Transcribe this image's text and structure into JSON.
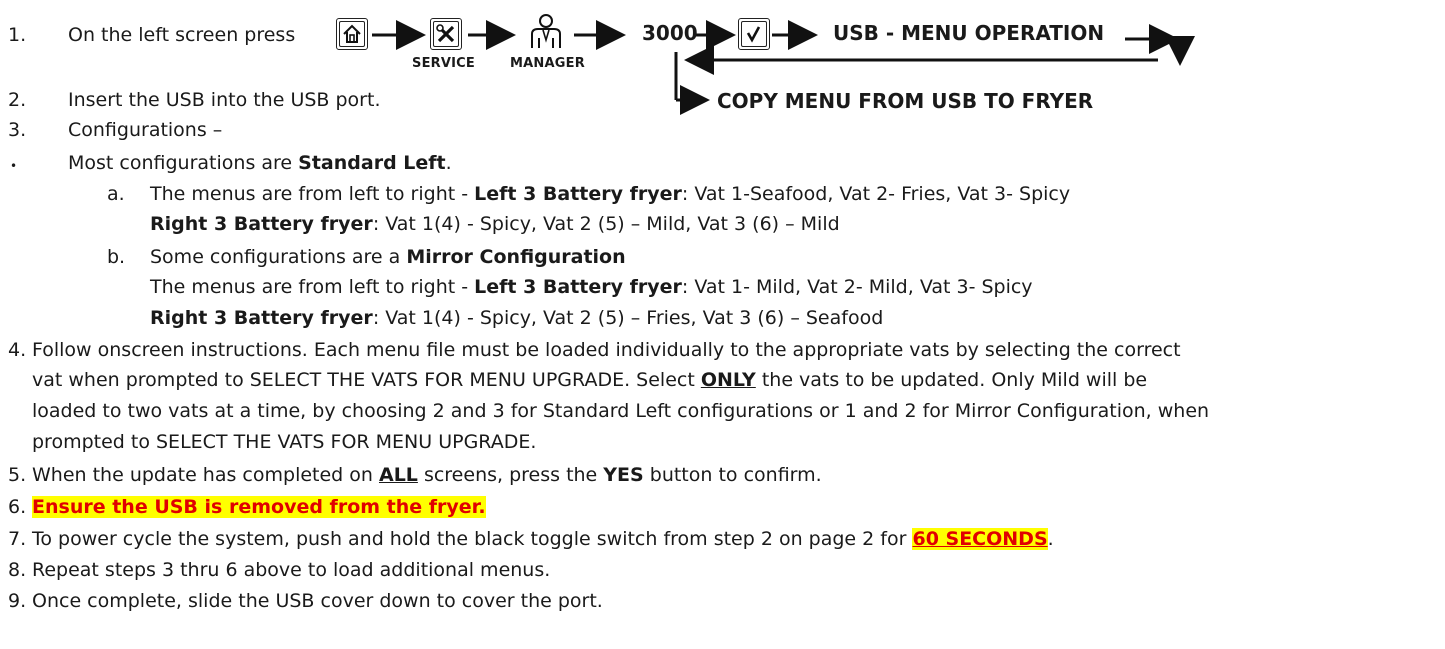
{
  "colors": {
    "text": "#1a1a1a",
    "highlight": "#ffff00",
    "warning_red": "#e00000",
    "border": "#222222"
  },
  "step1": {
    "number": "1.",
    "text": "On the left screen press",
    "icons": {
      "home": "home-icon",
      "service": "tools-icon",
      "manager": "manager-person-icon",
      "confirm": "checkmark-icon"
    },
    "service_caption": "SERVICE",
    "manager_caption": "MANAGER",
    "code": "3000",
    "menu_operation": "USB - MENU OPERATION",
    "copy_menu": "COPY MENU FROM USB TO FRYER"
  },
  "step2": {
    "number": "2.",
    "text": "Insert the USB into the USB port."
  },
  "step3": {
    "number": "3.",
    "text": "Configurations –"
  },
  "bullet": {
    "marker": "•",
    "prefix": "Most configurations are ",
    "bold": "Standard Left",
    "suffix": "."
  },
  "item_a": {
    "marker": "a.",
    "line1_prefix": "The menus are from left to right - ",
    "line1_bold": "Left 3 Battery fryer",
    "line1_rest": ": Vat 1-Seafood, Vat 2- Fries, Vat 3- Spicy",
    "line2_bold": "Right 3 Battery fryer",
    "line2_rest": ": Vat 1(4) - Spicy, Vat 2 (5) – Mild, Vat 3 (6) – Mild"
  },
  "item_b": {
    "marker": "b.",
    "line1_prefix": "Some configurations are a ",
    "line1_bold": "Mirror Configuration",
    "line2_prefix": "The menus are from left to right - ",
    "line2_bold": "Left 3 Battery fryer",
    "line2_rest": ": Vat 1- Mild, Vat 2- Mild, Vat 3- Spicy",
    "line3_bold": "Right 3 Battery fryer",
    "line3_rest": ": Vat 1(4) - Spicy, Vat 2 (5) – Fries, Vat 3 (6) – Seafood"
  },
  "step4": {
    "number": "4.",
    "line1": "Follow onscreen instructions.  Each menu file must be loaded individually to the appropriate vats by selecting the correct",
    "line2_prefix": "vat when prompted to SELECT THE VATS FOR MENU UPGRADE.  Select ",
    "line2_bold": "ONLY",
    "line2_rest": " the vats to be updated. Only Mild will be",
    "line3": "loaded to two vats at a time, by choosing 2 and 3 for Standard Left configurations or 1 and 2 for Mirror Configuration, when",
    "line4": "prompted to SELECT THE VATS FOR MENU UPGRADE."
  },
  "step5": {
    "number": "5.",
    "prefix": "When the update has completed on ",
    "bold1": "ALL",
    "middle": " screens, press the ",
    "bold2": "YES",
    "suffix": " button to confirm."
  },
  "step6": {
    "number": "6.",
    "text": "Ensure the USB is removed from the fryer."
  },
  "step7": {
    "number": "7.",
    "prefix": "To power cycle the system, push and hold the black toggle switch from step 2 on page 2 for ",
    "highlight": "60 SECONDS",
    "suffix": "."
  },
  "step8": {
    "number": "8.",
    "text": "Repeat steps 3 thru 6 above to load additional menus."
  },
  "step9": {
    "number": "9.",
    "text": "Once complete, slide the USB cover down to cover the port."
  }
}
